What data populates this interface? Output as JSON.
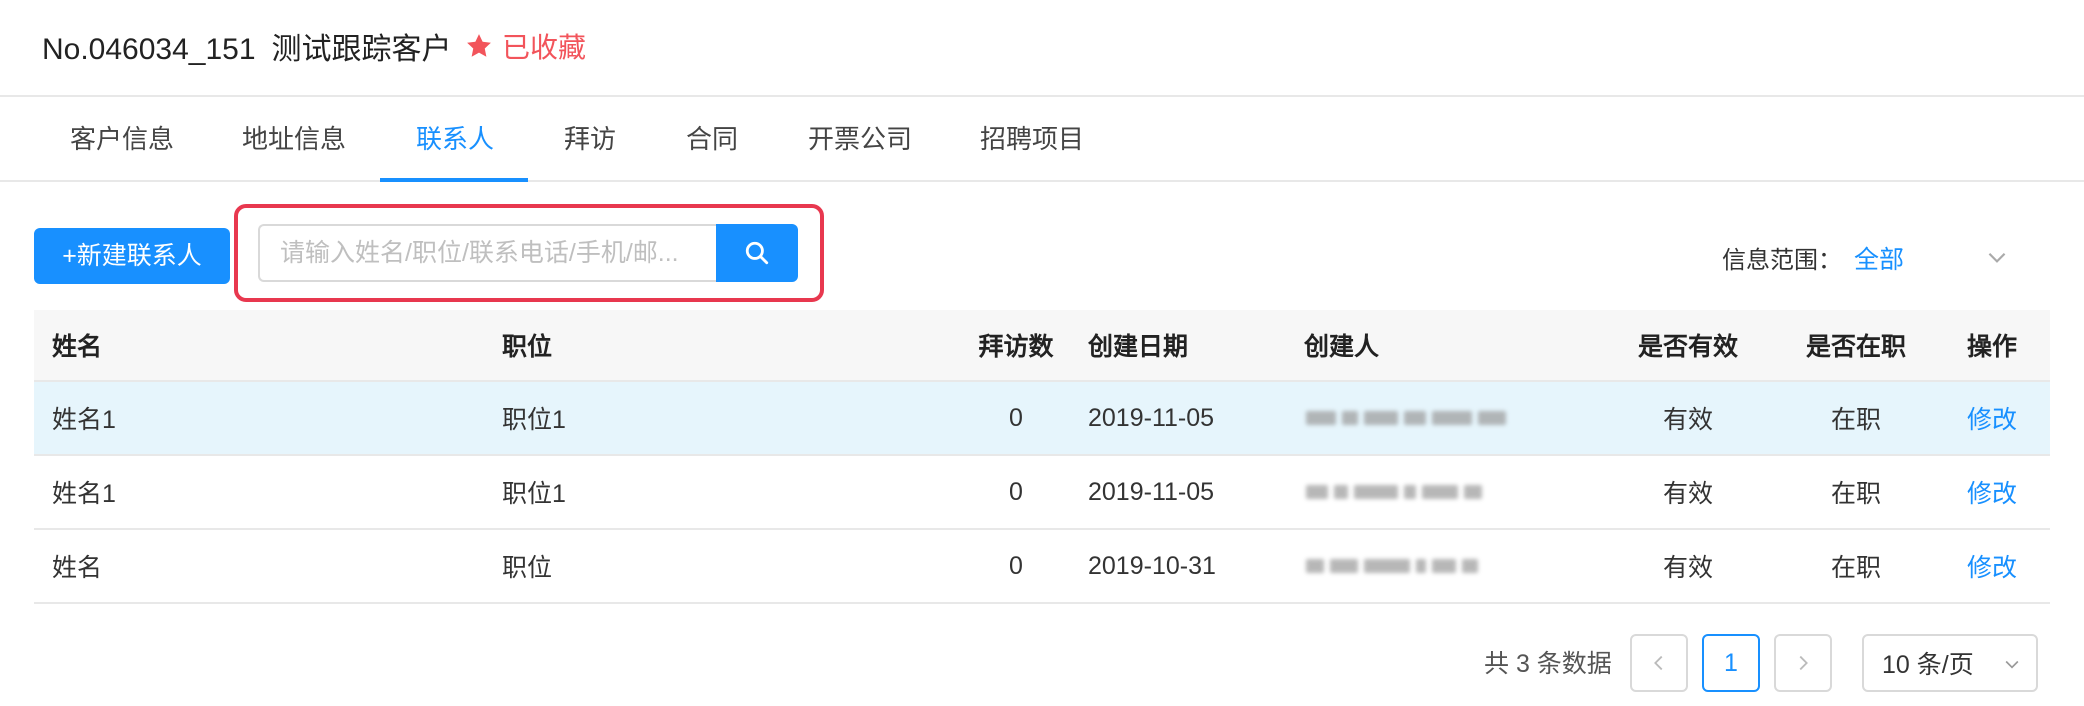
{
  "header": {
    "customer_code": "No.046034_151",
    "customer_name": "测试跟踪客户",
    "favorite_label": "已收藏",
    "favorite_color": "#f2545b"
  },
  "tabs": [
    {
      "label": "客户信息",
      "active": false
    },
    {
      "label": "地址信息",
      "active": false
    },
    {
      "label": "联系人",
      "active": true
    },
    {
      "label": "拜访",
      "active": false
    },
    {
      "label": "合同",
      "active": false
    },
    {
      "label": "开票公司",
      "active": false
    },
    {
      "label": "招聘项目",
      "active": false
    }
  ],
  "toolbar": {
    "new_contact_label": "+新建联系人",
    "search_placeholder": "请输入姓名/职位/联系电话/手机/邮...",
    "search_value": "",
    "scope_label": "信息范围：",
    "scope_value": "全部"
  },
  "table": {
    "columns": [
      "姓名",
      "职位",
      "拜访数",
      "创建日期",
      "创建人",
      "是否有效",
      "是否在职",
      "操作"
    ],
    "rows": [
      {
        "name": "姓名1",
        "position": "职位1",
        "visits": "0",
        "created": "2019-11-05",
        "creator": "",
        "valid": "有效",
        "employed": "在职",
        "action": "修改",
        "highlighted": true
      },
      {
        "name": "姓名1",
        "position": "职位1",
        "visits": "0",
        "created": "2019-11-05",
        "creator": "",
        "valid": "有效",
        "employed": "在职",
        "action": "修改",
        "highlighted": false
      },
      {
        "name": "姓名",
        "position": "职位",
        "visits": "0",
        "created": "2019-10-31",
        "creator": "",
        "valid": "有效",
        "employed": "在职",
        "action": "修改",
        "highlighted": false
      }
    ]
  },
  "pagination": {
    "total_text": "共 3 条数据",
    "current_page": "1",
    "page_size_label": "10 条/页"
  },
  "colors": {
    "accent": "#1890ff",
    "highlight_row": "#e6f5fc",
    "annotation_border": "#e8384f"
  }
}
